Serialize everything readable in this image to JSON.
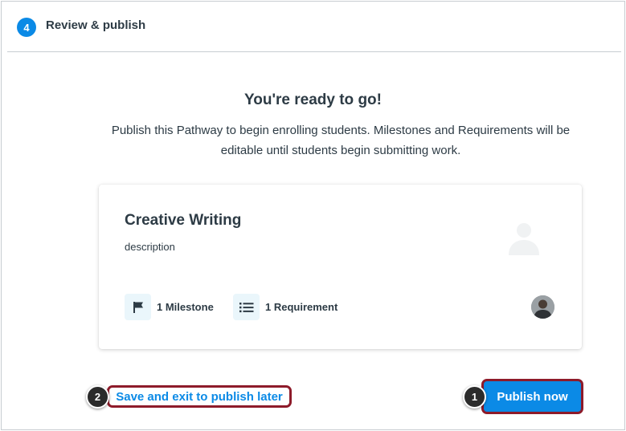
{
  "step": {
    "number": "4",
    "title": "Review & publish"
  },
  "ready": {
    "title": "You're ready to go!",
    "description": "Publish this Pathway to begin enrolling students. Milestones and Requirements will be editable until students begin submitting work."
  },
  "card": {
    "title": "Creative Writing",
    "description": "description",
    "milestones": "1 Milestone",
    "requirements": "1 Requirement",
    "icons": {
      "milestone": "flag-icon",
      "requirement": "list-icon",
      "placeholder": "user-placeholder-icon"
    }
  },
  "actions": {
    "save_label": "Save and exit to publish later",
    "publish_label": "Publish now"
  },
  "callouts": {
    "publish": "1",
    "save": "2"
  },
  "colors": {
    "accent": "#0b8ae6",
    "callout_border": "#8e1b2a",
    "text": "#2d3b45",
    "icon_bg": "#eaf6fb"
  }
}
